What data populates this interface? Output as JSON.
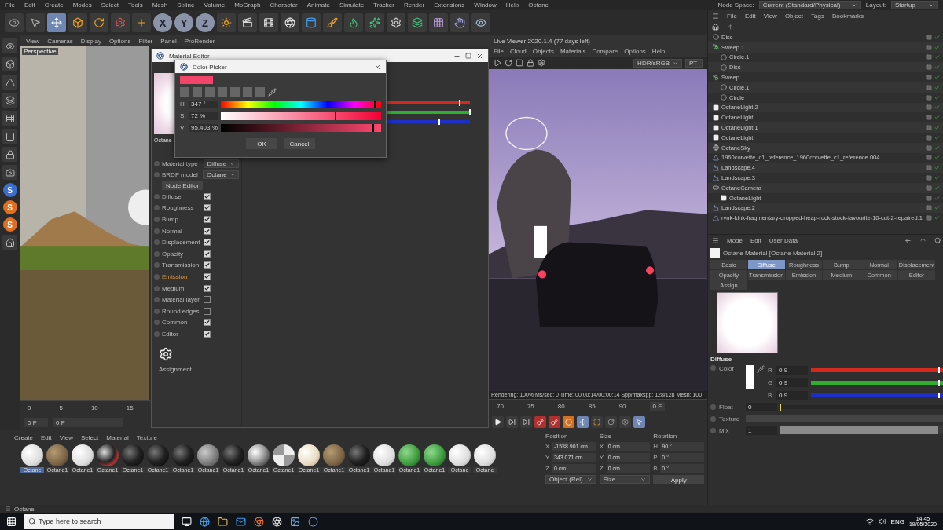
{
  "menu_bar": {
    "items": [
      "File",
      "Edit",
      "Create",
      "Modes",
      "Select",
      "Tools",
      "Mesh",
      "Spline",
      "Volume",
      "MoGraph",
      "Character",
      "Animate",
      "Simulate",
      "Tracker",
      "Render",
      "Extensions",
      "Window",
      "Help",
      "Octane"
    ],
    "node_space_label": "Node Space:",
    "node_space_value": "Current (Standard/Physical)",
    "layout_label": "Layout:",
    "layout_value": "Startup"
  },
  "toolbar": {
    "axis_buttons": [
      "X",
      "Y",
      "Z"
    ]
  },
  "left_tools": {
    "badges": [
      "S",
      "S",
      "S"
    ]
  },
  "viewport": {
    "menu": [
      "View",
      "Cameras",
      "Display",
      "Options",
      "Filter",
      "Panel",
      "ProRender"
    ],
    "camera_label": "Perspective",
    "ruler_ticks": [
      "0",
      "5",
      "10",
      "15"
    ],
    "frame_start": "0 F",
    "frame_current": "0 F"
  },
  "material_editor": {
    "title": "Material Editor",
    "name": "Octane",
    "material_type_label": "Material type",
    "material_type": "Diffuse",
    "brdf_label": "BRDF model",
    "brdf": "Octane",
    "node_editor_button": "Node Editor",
    "channels": [
      {
        "name": "Diffuse",
        "checked": true,
        "highlighted": false
      },
      {
        "name": "Roughness",
        "checked": true,
        "highlighted": false
      },
      {
        "name": "Bump",
        "checked": true,
        "highlighted": false
      },
      {
        "name": "Normal",
        "checked": true,
        "highlighted": false
      },
      {
        "name": "Displacement",
        "checked": true,
        "highlighted": false
      },
      {
        "name": "Opacity",
        "checked": true,
        "highlighted": false
      },
      {
        "name": "Transmission",
        "checked": true,
        "highlighted": false
      },
      {
        "name": "Emission",
        "checked": true,
        "highlighted": true
      },
      {
        "name": "Medium",
        "checked": true,
        "highlighted": false
      },
      {
        "name": "Material layer",
        "checked": false,
        "highlighted": false
      },
      {
        "name": "Round edges",
        "checked": false,
        "highlighted": false
      },
      {
        "name": "Common",
        "checked": true,
        "highlighted": false
      },
      {
        "name": "Editor",
        "checked": true,
        "highlighted": false
      }
    ],
    "logo_caption": "Assignment",
    "rgb": [
      {
        "color": "#d42a1e",
        "level": 0.9
      },
      {
        "color": "#2fae2f",
        "level": 1
      },
      {
        "color": "#1d2fc8",
        "level": 0.7
      }
    ]
  },
  "color_picker": {
    "title": "Color Picker",
    "fields": [
      {
        "label": "H",
        "value": "347 °",
        "level": 0.964
      },
      {
        "label": "S",
        "value": "72 %",
        "level": 0.72
      },
      {
        "label": "V",
        "value": "95.403 %",
        "level": 0.954
      }
    ],
    "buttons": [
      "OK",
      "Cancel"
    ]
  },
  "live_viewer": {
    "title": "Live Viewer 2020.1.4 (77 days left)",
    "menu": [
      "File",
      "Cloud",
      "Objects",
      "Materials",
      "Compare",
      "Options",
      "Help"
    ],
    "render_mode": "HDR/sRGB",
    "kernel": "PT",
    "status": "Rendering: 100%  Ms/sec: 0  Time: 00:00:14/00:00:14  Spp/maxspp: 128/128  Mesh: 100",
    "ruler_ticks": [
      "70",
      "75",
      "80",
      "85",
      "90"
    ],
    "frame_field": "0 F"
  },
  "coordinates": {
    "headers": [
      "Position",
      "Size",
      "Rotation"
    ],
    "rows": [
      {
        "axis": "X",
        "position": "-1538.901 cm",
        "size_axis": "X",
        "size": "0 cm",
        "rot_axis": "H",
        "rotation": "90 °"
      },
      {
        "axis": "Y",
        "position": "343.071 cm",
        "size_axis": "Y",
        "size": "0 cm",
        "rot_axis": "P",
        "rotation": "0 °"
      },
      {
        "axis": "Z",
        "position": "0 cm",
        "size_axis": "Z",
        "size": "0 cm",
        "rot_axis": "B",
        "rotation": "0 °"
      }
    ],
    "mode": "Object (Rel)",
    "size_mode": "Size",
    "apply": "Apply"
  },
  "material_bar": {
    "menu": [
      "Create",
      "Edit",
      "View",
      "Select",
      "Material",
      "Texture"
    ],
    "materials": [
      {
        "name": "Octane",
        "kind": "white",
        "selected": true
      },
      {
        "name": "Octane1",
        "kind": "wood",
        "selected": false
      },
      {
        "name": "Octane1",
        "kind": "white",
        "selected": false
      },
      {
        "name": "Octane1",
        "kind": "pattern",
        "selected": false
      },
      {
        "name": "Octane1",
        "kind": "black",
        "selected": false
      },
      {
        "name": "Octane1",
        "kind": "black",
        "selected": false
      },
      {
        "name": "Octane1",
        "kind": "black",
        "selected": false
      },
      {
        "name": "Octane1",
        "kind": "grey",
        "selected": false
      },
      {
        "name": "Octane1",
        "kind": "black",
        "selected": false
      },
      {
        "name": "Octane1",
        "kind": "chrome",
        "selected": false
      },
      {
        "name": "Octane1",
        "kind": "checker",
        "selected": false
      },
      {
        "name": "Octane1",
        "kind": "cream",
        "selected": false
      },
      {
        "name": "Octane1",
        "kind": "wood",
        "selected": false
      },
      {
        "name": "Octane1",
        "kind": "black",
        "selected": false
      },
      {
        "name": "Octane1",
        "kind": "white",
        "selected": false
      },
      {
        "name": "Octane1",
        "kind": "green",
        "selected": false
      },
      {
        "name": "Octane1",
        "kind": "green",
        "selected": false
      },
      {
        "name": "Octane",
        "kind": "white",
        "selected": false
      },
      {
        "name": "Octane",
        "kind": "white",
        "selected": false
      }
    ]
  },
  "object_manager": {
    "menu": [
      "File",
      "Edit",
      "View",
      "Object",
      "Tags",
      "Bookmarks"
    ],
    "objects": [
      {
        "name": "Disc",
        "kind": "null"
      },
      {
        "name": "Sweep.1",
        "kind": "spline",
        "children": [
          {
            "name": "Circle.1",
            "kind": "null"
          },
          {
            "name": "Disc",
            "kind": "null"
          }
        ]
      },
      {
        "name": "Sweep",
        "kind": "spline",
        "children": [
          {
            "name": "Circle.1",
            "kind": "null"
          },
          {
            "name": "Circle",
            "kind": "null"
          }
        ]
      },
      {
        "name": "OctaneLight.2",
        "kind": "light"
      },
      {
        "name": "OctaneLight",
        "kind": "light"
      },
      {
        "name": "OctaneLight.1",
        "kind": "light"
      },
      {
        "name": "OctaneLight",
        "kind": "light"
      },
      {
        "name": "OctaneSky",
        "kind": "sky"
      },
      {
        "name": "1960corvette_c1_reference_1960corvette_c1_reference.004",
        "kind": "mesh"
      },
      {
        "name": "Landscape.4",
        "kind": "landscape"
      },
      {
        "name": "Landscape.3",
        "kind": "landscape"
      },
      {
        "name": "OctaneCamera",
        "kind": "camera",
        "children": [
          {
            "name": "OctaneLight",
            "kind": "light"
          }
        ]
      },
      {
        "name": "Landscape.2",
        "kind": "landscape"
      },
      {
        "name": "rynk-kink-fragmentary-dropped-heap-rock-stock-favourite-10-cut-2-repaired.1",
        "kind": "mesh"
      }
    ]
  },
  "attribute_manager": {
    "menu": [
      "Mode",
      "Edit",
      "User Data"
    ],
    "material_name": "Octane Material [Octane Material.2]",
    "tabs": [
      {
        "label": "Basic",
        "selected": false
      },
      {
        "label": "Diffuse",
        "selected": true
      },
      {
        "label": "Roughness",
        "selected": false
      },
      {
        "label": "Bump",
        "selected": false
      },
      {
        "label": "Normal",
        "selected": false
      },
      {
        "label": "Displacement",
        "selected": false
      },
      {
        "label": "Opacity",
        "selected": false
      },
      {
        "label": "Transmission",
        "selected": false
      },
      {
        "label": "Emission",
        "selected": false
      },
      {
        "label": "Medium",
        "selected": false
      },
      {
        "label": "Common",
        "selected": false
      },
      {
        "label": "Editor",
        "selected": false
      },
      {
        "label": "Assign",
        "selected": false
      }
    ],
    "section": "Diffuse",
    "color_label": "Color",
    "rgb": [
      {
        "color": "#d42a1e",
        "label": "R",
        "value": "0.9",
        "level": 0.97
      },
      {
        "color": "#2fae2f",
        "label": "G",
        "value": "0.9",
        "level": 0.97
      },
      {
        "color": "#1d2fc8",
        "label": "B",
        "value": "0.9",
        "level": 0.97
      }
    ],
    "float": {
      "label": "Float",
      "value": "0",
      "level": 0
    },
    "texture_label": "Texture",
    "mix": {
      "label": "Mix",
      "value": "1",
      "level": 0.97
    }
  },
  "status_bar": {
    "text": "Octane"
  },
  "taskbar": {
    "search_placeholder": "Type here to search",
    "language": "ENG",
    "time": "14:45",
    "date": "19/05/2020"
  }
}
